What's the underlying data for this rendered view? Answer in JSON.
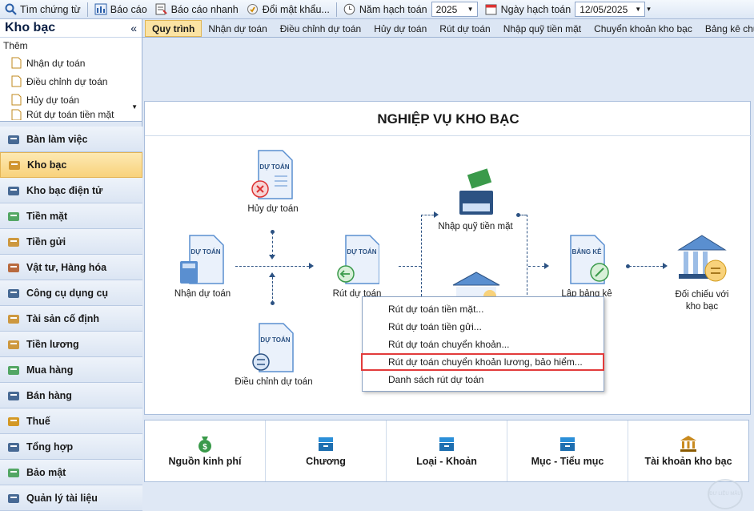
{
  "toolbar": {
    "search": "Tìm chứng từ",
    "report": "Báo cáo",
    "quick_report": "Báo cáo nhanh",
    "change_password": "Đổi mật khẩu...",
    "fiscal_year_label": "Năm hạch toán",
    "fiscal_year_value": "2025",
    "posting_date_label": "Ngày hạch toán",
    "posting_date_value": "12/05/2025"
  },
  "sidebar": {
    "title": "Kho bạc",
    "collapse": "«",
    "tree_title": "Thêm",
    "tree_items": [
      "Nhận dự toán",
      "Điều chỉnh dự toán",
      "Hủy dự toán",
      "Rút dự toán tiền mặt"
    ],
    "nav": [
      {
        "label": "Bàn làm việc",
        "icon": "desk-icon"
      },
      {
        "label": "Kho bạc",
        "icon": "treasury-icon",
        "active": true
      },
      {
        "label": "Kho bạc điện tử",
        "icon": "e-treasury-icon"
      },
      {
        "label": "Tiền mặt",
        "icon": "cash-icon"
      },
      {
        "label": "Tiền gửi",
        "icon": "deposit-icon"
      },
      {
        "label": "Vật tư, Hàng hóa",
        "icon": "goods-icon"
      },
      {
        "label": "Công cụ dụng cụ",
        "icon": "tools-icon"
      },
      {
        "label": "Tài sản cố định",
        "icon": "assets-icon"
      },
      {
        "label": "Tiền lương",
        "icon": "salary-icon"
      },
      {
        "label": "Mua hàng",
        "icon": "cart-icon"
      },
      {
        "label": "Bán hàng",
        "icon": "sales-icon"
      },
      {
        "label": "Thuế",
        "icon": "tax-icon"
      },
      {
        "label": "Tổng hợp",
        "icon": "summary-icon"
      },
      {
        "label": "Bảo mật",
        "icon": "security-icon"
      },
      {
        "label": "Quản lý tài liệu",
        "icon": "documents-icon"
      }
    ]
  },
  "tabs": [
    "Quy trình",
    "Nhận dự toán",
    "Điều chỉnh dự toán",
    "Hủy dự toán",
    "Rút dự toán",
    "Nhập quỹ tiền mặt",
    "Chuyển khoản kho bạc",
    "Bảng kê chứng từ thanh"
  ],
  "diagram": {
    "title": "NGHIỆP VỤ KHO BẠC",
    "doc_tag": "DỰ TOÁN",
    "list_tag": "BẢNG KÊ",
    "cancel": "Hủy dự toán",
    "receive": "Nhận dự toán",
    "adjust": "Điều chỉnh dự toán",
    "withdraw": "Rút dự toán",
    "cash_in": "Nhập quỹ tiền mặt",
    "listing": "Lập bảng kê",
    "reconcile": "Đối chiếu với kho bạc"
  },
  "context_menu": [
    "Rút dự toán tiền mặt...",
    "Rút dự toán tiền gửi...",
    "Rút dự toán chuyển khoản...",
    "Rút dự toán chuyển khoản lương, bảo hiểm...",
    "Danh sách rút dự toán"
  ],
  "bottom": [
    "Nguồn kinh phí",
    "Chương",
    "Loại - Khoản",
    "Mục - Tiểu mục",
    "Tài khoản kho bạc"
  ],
  "watermark": "ĐƯ LIỆU MẪU",
  "colors": {
    "accent": "#f8d27b",
    "highlight": "#e23b3b",
    "navy": "#2c5283",
    "green": "#3a9a4a",
    "doc_blue": "#5a8fd0"
  }
}
